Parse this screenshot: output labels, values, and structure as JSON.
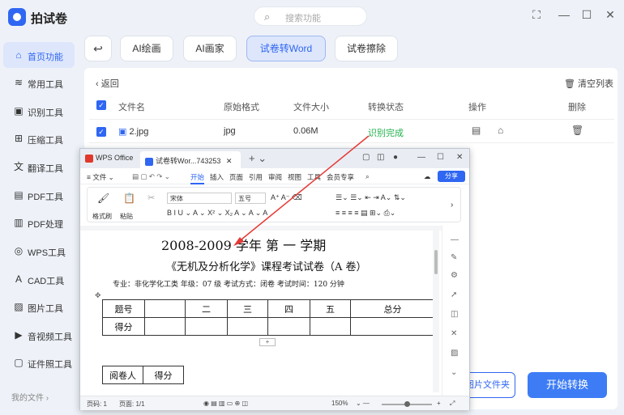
{
  "app": {
    "name": "拍试卷",
    "search_placeholder": "搜索功能"
  },
  "window_controls": [
    "⛶",
    "—",
    "☐",
    "✕"
  ],
  "sidebar": {
    "items": [
      {
        "label": "首页功能",
        "icon": "home-icon",
        "glyph": "⌂"
      },
      {
        "label": "常用工具",
        "icon": "layers-icon",
        "glyph": "≋"
      },
      {
        "label": "识别工具",
        "icon": "scan-icon",
        "glyph": "▣"
      },
      {
        "label": "压缩工具",
        "icon": "compress-icon",
        "glyph": "⊞"
      },
      {
        "label": "翻译工具",
        "icon": "translate-icon",
        "glyph": "文"
      },
      {
        "label": "PDF工具",
        "icon": "pdf-icon",
        "glyph": "▤"
      },
      {
        "label": "PDF处理",
        "icon": "pdf-process-icon",
        "glyph": "▥"
      },
      {
        "label": "WPS工具",
        "icon": "wps-icon",
        "glyph": "◎"
      },
      {
        "label": "CAD工具",
        "icon": "cad-icon",
        "glyph": "A"
      },
      {
        "label": "图片工具",
        "icon": "image-icon",
        "glyph": "▨"
      },
      {
        "label": "音视频工具",
        "icon": "video-icon",
        "glyph": "▶"
      },
      {
        "label": "证件照工具",
        "icon": "id-photo-icon",
        "glyph": "▢"
      }
    ],
    "my_files": "我的文件 ›"
  },
  "tabs": [
    {
      "label": "AI绘画"
    },
    {
      "label": "AI画家"
    },
    {
      "label": "试卷转Word"
    },
    {
      "label": "试卷擦除"
    }
  ],
  "panel": {
    "back": "‹ 返回",
    "clear": "清空列表",
    "headers": [
      "文件名",
      "原始格式",
      "文件大小",
      "转换状态",
      "操作",
      "删除"
    ],
    "row": {
      "name": "2.jpg",
      "format": "jpg",
      "size": "0.06M",
      "status": "识别完成"
    },
    "folder_btn": "图片文件夹",
    "convert_btn": "开始转换"
  },
  "wps": {
    "tab1": "WPS Office",
    "tab2": "试卷转Wor...743253",
    "menu": [
      "≡ 文件 ⌄",
      "开始",
      "插入",
      "页面",
      "引用",
      "审阅",
      "视图",
      "工具",
      "会员专享"
    ],
    "share": "分享",
    "font": "宋体",
    "size": "五号",
    "ribbon_labels": [
      "格式刷",
      "粘贴"
    ],
    "status_page": "页码: 1",
    "status_pages": "页面: 1/1",
    "zoom": "150%"
  },
  "doc": {
    "title": "2008-2009 学年  第 一 学期",
    "subtitle": "《无机及分析化学》课程考试试卷（A 卷）",
    "info": "专业：非化学化工类   年级：07 级   考试方式：闭卷   考试时间：120 分钟",
    "score_table": {
      "row1": [
        "题号",
        "",
        "二",
        "三",
        "四",
        "五",
        "总分"
      ],
      "row2": [
        "得分",
        "",
        "",
        "",
        "",
        "",
        ""
      ]
    },
    "grader": [
      "阅卷人",
      "得分"
    ]
  }
}
